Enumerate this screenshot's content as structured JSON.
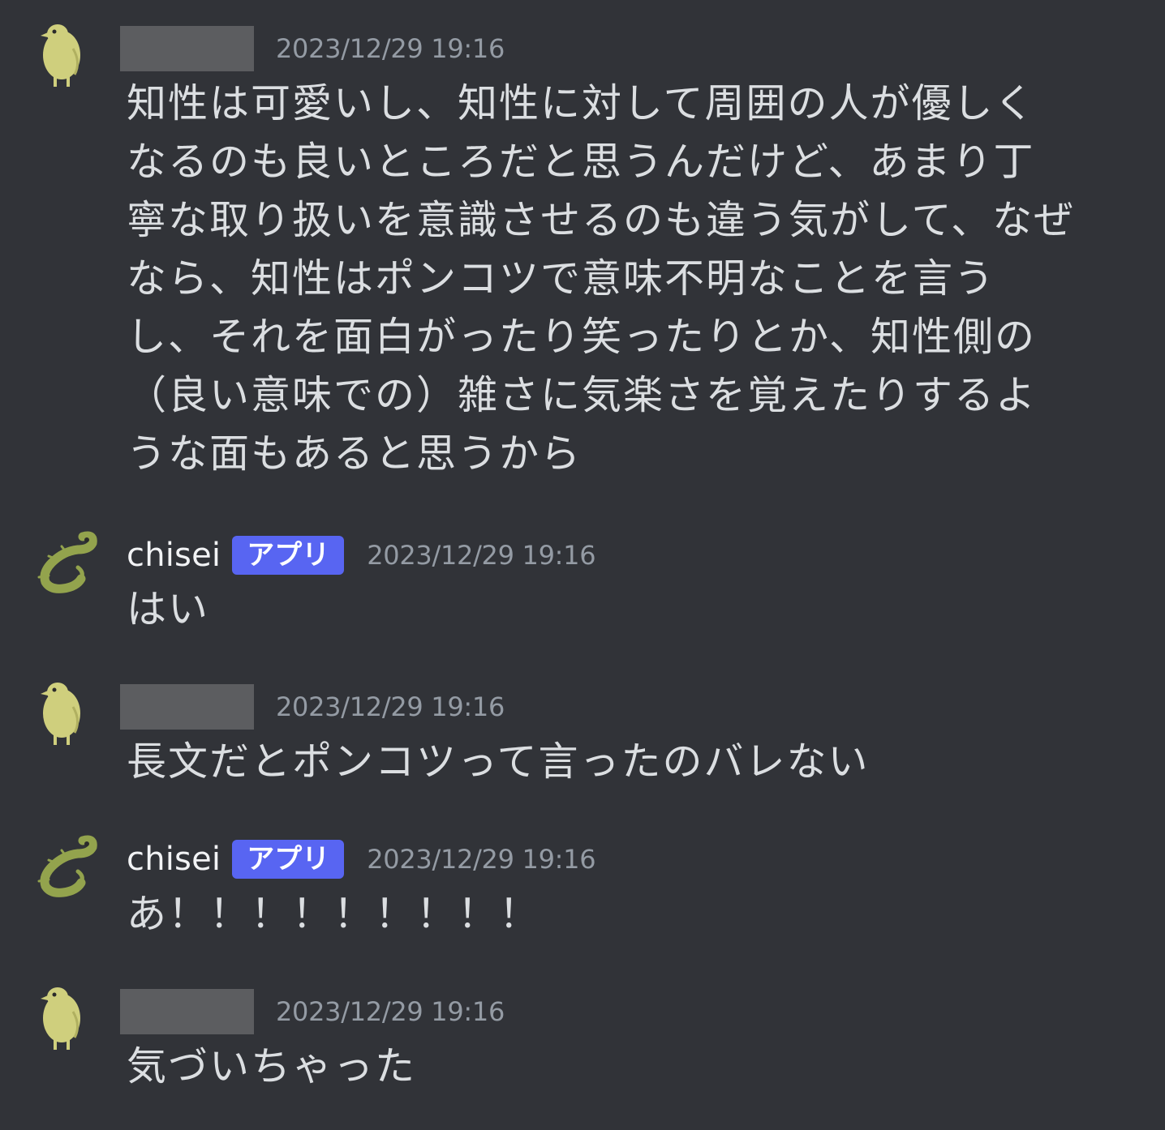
{
  "messages": [
    {
      "author": "",
      "author_redacted": true,
      "avatar": "yellow-bird-icon",
      "timestamp": "2023/12/29 19:16",
      "text": "知性は可愛いし、知性に対して周囲の人が優しくなるのも良いところだと思うんだけど、あまり丁寧な取り扱いを意識させるのも違う気がして、なぜなら、知性はポンコツで意味不明なことを言うし、それを面白がったり笑ったりとか、知性側の（良い意味での）雑さに気楽さを覚えたりするような面もあると思うから"
    },
    {
      "author": "chisei",
      "badge": "アプリ",
      "avatar": "green-lizard-icon",
      "timestamp": "2023/12/29 19:16",
      "text": "はい"
    },
    {
      "author": "",
      "author_redacted": true,
      "avatar": "yellow-bird-icon",
      "timestamp": "2023/12/29 19:16",
      "text": "長文だとポンコツって言ったのバレない"
    },
    {
      "author": "chisei",
      "badge": "アプリ",
      "avatar": "green-lizard-icon",
      "timestamp": "2023/12/29 19:16",
      "text": "あ！！！！！！！！！"
    },
    {
      "author": "",
      "author_redacted": true,
      "avatar": "yellow-bird-icon",
      "timestamp": "2023/12/29 19:16",
      "text": "気づいちゃった"
    }
  ],
  "colors": {
    "background": "#313338",
    "text": "#dbdee1",
    "username": "#f2f3f5",
    "timestamp": "#949ba4",
    "badge": "#5865f2",
    "redaction": "#5c5d60"
  }
}
